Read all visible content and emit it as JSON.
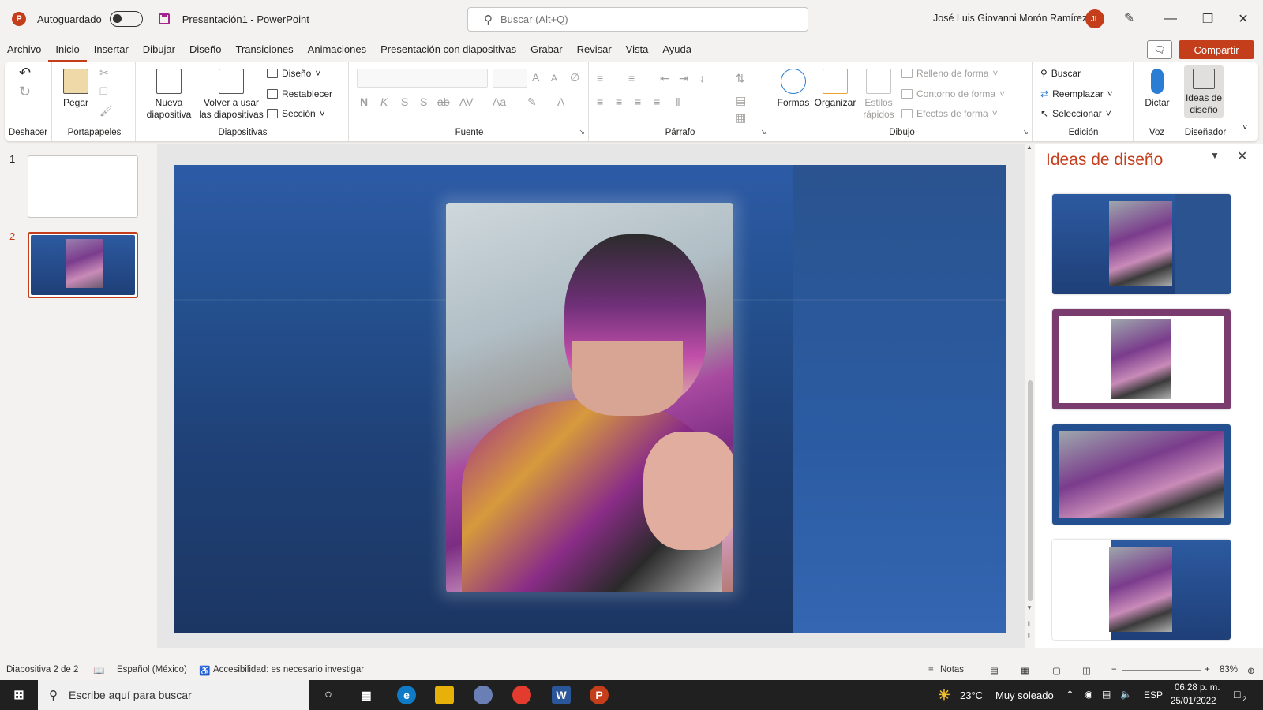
{
  "titlebar": {
    "app_logo": "P",
    "autosave_label": "Autoguardado",
    "doc_title": "Presentación1  -  PowerPoint",
    "search_placeholder": "Buscar (Alt+Q)",
    "user_name": "José Luis Giovanni Morón Ramírez",
    "user_initials": "JL"
  },
  "menu": {
    "tabs": [
      "Archivo",
      "Inicio",
      "Insertar",
      "Dibujar",
      "Diseño",
      "Transiciones",
      "Animaciones",
      "Presentación con diapositivas",
      "Grabar",
      "Revisar",
      "Vista",
      "Ayuda"
    ],
    "active": "Inicio",
    "share_label": "Compartir"
  },
  "ribbon": {
    "undo_group": "Deshacer",
    "clipboard": {
      "group": "Portapapeles",
      "paste": "Pegar"
    },
    "slides": {
      "group": "Diapositivas",
      "new_slide": "Nueva diapositiva",
      "reuse": "Volver a usar las diapositivas",
      "layout": "Diseño",
      "reset": "Restablecer",
      "section": "Sección"
    },
    "font": {
      "group": "Fuente",
      "bold": "N",
      "italic": "K",
      "underline": "S",
      "shadow": "S",
      "strike": "ab",
      "spacing": "AV",
      "case": "Aa",
      "grow": "A",
      "shrink": "A"
    },
    "paragraph": {
      "group": "Párrafo"
    },
    "drawing": {
      "group": "Dibujo",
      "shapes": "Formas",
      "arrange": "Organizar",
      "quick_styles": "Estilos rápidos",
      "fill": "Relleno de forma",
      "outline": "Contorno de forma",
      "effects": "Efectos de forma"
    },
    "editing": {
      "group": "Edición",
      "find": "Buscar",
      "replace": "Reemplazar",
      "select": "Seleccionar"
    },
    "voice": {
      "group": "Voz",
      "dictate": "Dictar"
    },
    "designer": {
      "group": "Diseñador",
      "ideas": "Ideas de diseño"
    }
  },
  "thumbnails": [
    {
      "number": "1",
      "selected": false
    },
    {
      "number": "2",
      "selected": true
    }
  ],
  "design_pane": {
    "title": "Ideas de diseño"
  },
  "statusbar": {
    "slide_info": "Diapositiva 2 de 2",
    "language": "Español (México)",
    "accessibility": "Accesibilidad: es necesario investigar",
    "notes": "Notas",
    "zoom": "83%"
  },
  "taskbar": {
    "search_placeholder": "Escribe aquí para buscar",
    "weather_temp": "23°C",
    "weather_desc": "Muy soleado",
    "language": "ESP",
    "time": "06:28 p. m.",
    "date": "25/01/2022",
    "notifications": "2"
  },
  "colors": {
    "accent": "#c43e1c",
    "slide_blue": "#24508f",
    "taskbar": "#202020"
  }
}
